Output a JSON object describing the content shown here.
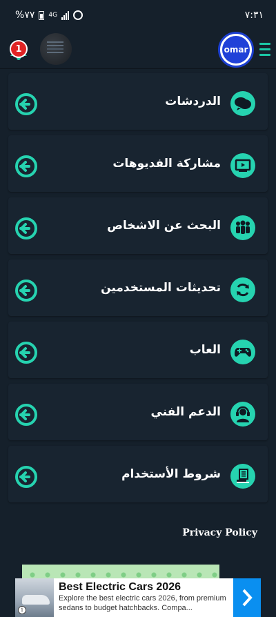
{
  "status_bar": {
    "battery": "%٧٧",
    "network": "4G",
    "time": "٧:٣١"
  },
  "header": {
    "notification_count": "1",
    "logo_text": "omar"
  },
  "menu": {
    "items": [
      {
        "label": "الدردشات",
        "icon": "chat-bubbles-icon"
      },
      {
        "label": "مشاركة الفديوهات",
        "icon": "video-play-icon"
      },
      {
        "label": "البحث عن الاشخاص",
        "icon": "people-group-icon"
      },
      {
        "label": "تحديثات المستخدمين",
        "icon": "refresh-icon"
      },
      {
        "label": "العاب",
        "icon": "gamepad-icon"
      },
      {
        "label": "الدعم الفني",
        "icon": "support-agent-icon"
      },
      {
        "label": "شروط الأستخدام",
        "icon": "terms-document-icon"
      }
    ],
    "go_icon": "arrow-enter-icon"
  },
  "privacy_link": "Privacy Policy",
  "ad": {
    "title": "Best Electric Cars 2026",
    "description": "Explore the best electric cars 2026, from premium sedans to budget hatchbacks. Compa...",
    "info_glyph": "i"
  },
  "colors": {
    "background": "#15202b",
    "card": "#182430",
    "accent": "#26d3b0",
    "badge": "#e02424",
    "ad_arrow": "#0a8ff0"
  }
}
